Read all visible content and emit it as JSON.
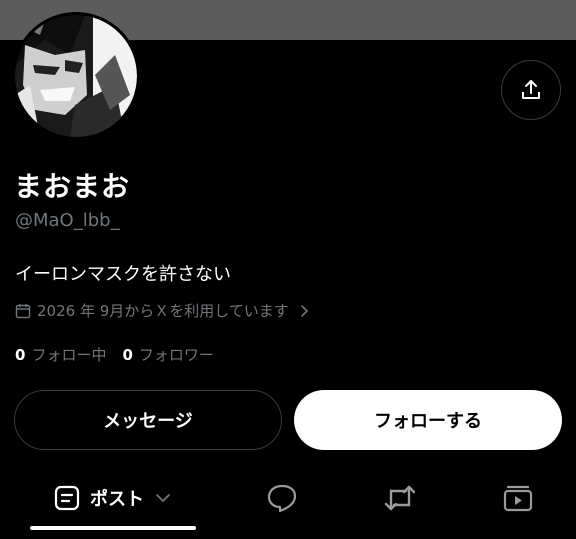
{
  "profile": {
    "display_name": "まおまお",
    "handle": "@MaO_lbb_",
    "bio": "イーロンマスクを許さない",
    "joined": "2026 年 9月からＸを利用しています",
    "following_count": "0",
    "following_label": "フォロー中",
    "followers_count": "0",
    "followers_label": "フォロワー"
  },
  "actions": {
    "message_label": "メッセージ",
    "follow_label": "フォローする"
  },
  "tabs": {
    "posts_label": "ポスト"
  },
  "colors": {
    "background": "#000000",
    "banner": "#5b5b5b",
    "muted_text": "#71767b",
    "border": "#3a3a3a"
  },
  "icons": [
    "share-icon",
    "calendar-icon",
    "chevron-right-icon",
    "posts-icon",
    "chevron-down-icon",
    "reply-icon",
    "repost-icon",
    "video-icon"
  ]
}
